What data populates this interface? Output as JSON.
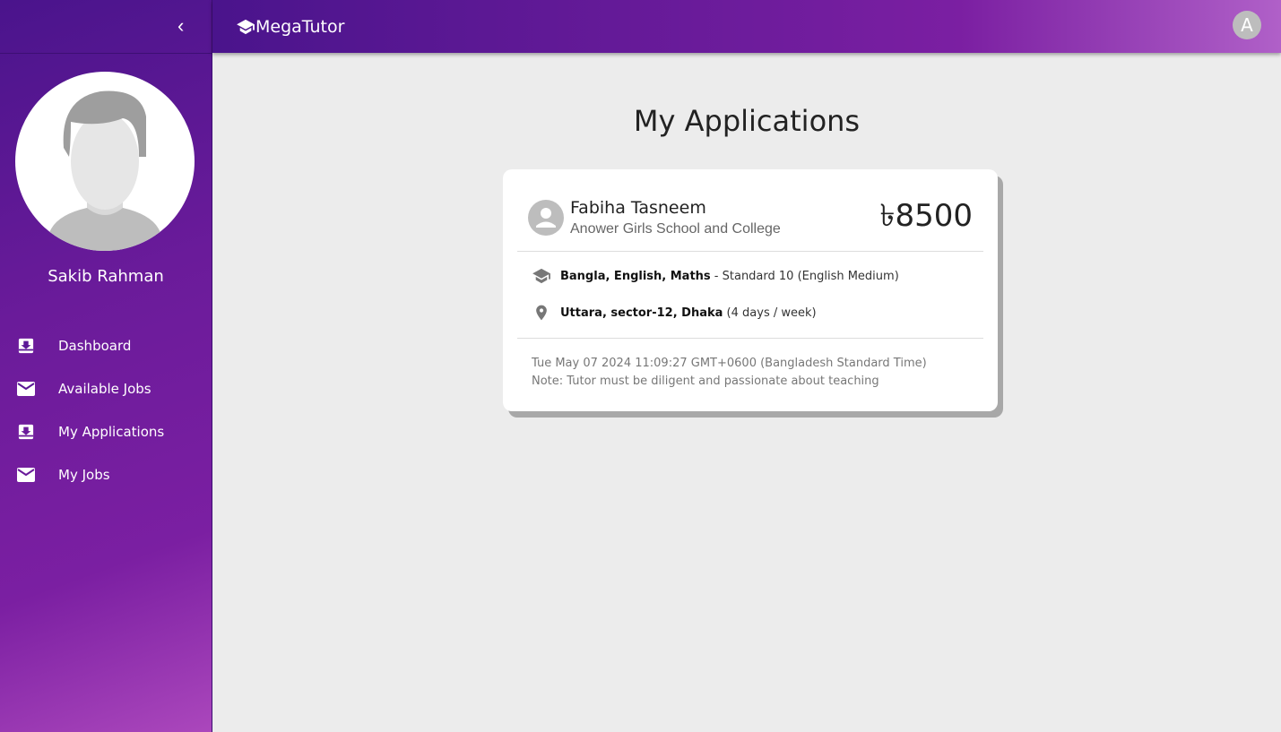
{
  "sidebar": {
    "user_name": "Sakib Rahman",
    "items": [
      {
        "label": "Dashboard",
        "icon": "inbox-download-icon"
      },
      {
        "label": "Available Jobs",
        "icon": "mail-icon"
      },
      {
        "label": "My Applications",
        "icon": "inbox-download-icon"
      },
      {
        "label": "My Jobs",
        "icon": "mail-icon"
      }
    ]
  },
  "topbar": {
    "brand": "MegaTutor",
    "user_initial": "A"
  },
  "page": {
    "title": "My Applications"
  },
  "applications": [
    {
      "name": "Fabiha Tasneem",
      "school": "Anower Girls School and College",
      "salary": "৳8500",
      "subjects": "Bangla, English, Maths",
      "class_info": " - Standard 10 (English Medium)",
      "location": "Uttara, sector-12, Dhaka",
      "schedule": " (4 days / week)",
      "date": "Tue May 07 2024 11:09:27 GMT+0600 (Bangladesh Standard Time)",
      "note": "Note: Tutor must be diligent and passionate about teaching"
    }
  ],
  "colors": {
    "primary": "#4a148c",
    "accent": "#7b1fa2"
  }
}
